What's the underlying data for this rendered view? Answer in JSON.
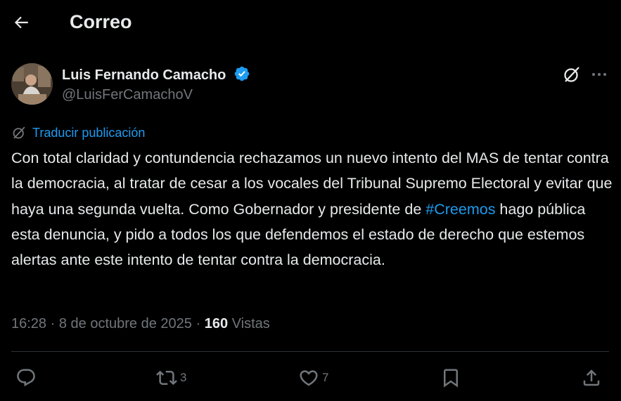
{
  "header": {
    "title": "Correo",
    "back_icon": "arrow-left-icon"
  },
  "author": {
    "name": "Luis Fernando Camacho",
    "handle": "@LuisFerCamachoV",
    "verified": true,
    "verified_color": "#1d9bf0"
  },
  "translate": {
    "label": "Traducir publicación"
  },
  "post": {
    "text_before": "Con total claridad y contundencia rechazamos un nuevo intento del MAS de tentar contra la democracia, al tratar de cesar a los vocales del Tribunal Supremo Electoral y evitar que haya una segunda vuelta. Como Gobernador y presidente de ",
    "hashtag": "#Creemos",
    "text_after": " hago pública esta denuncia, y pido a todos los que defendemos el estado de derecho que estemos alertas ante este intento de tentar contra la democracia."
  },
  "meta": {
    "time": "16:28",
    "separator": "·",
    "date": "8 de octubre de 2025",
    "views_count": "160",
    "views_label": "Vistas"
  },
  "actions": {
    "reply": {
      "icon": "reply-icon",
      "count": ""
    },
    "repost": {
      "icon": "repost-icon",
      "count": "3"
    },
    "like": {
      "icon": "heart-icon",
      "count": "7"
    },
    "bookmark": {
      "icon": "bookmark-icon",
      "count": ""
    },
    "share": {
      "icon": "share-icon",
      "count": ""
    }
  },
  "colors": {
    "background": "#000000",
    "text": "#e7e9ea",
    "muted": "#71767b",
    "accent": "#1d9bf0"
  }
}
